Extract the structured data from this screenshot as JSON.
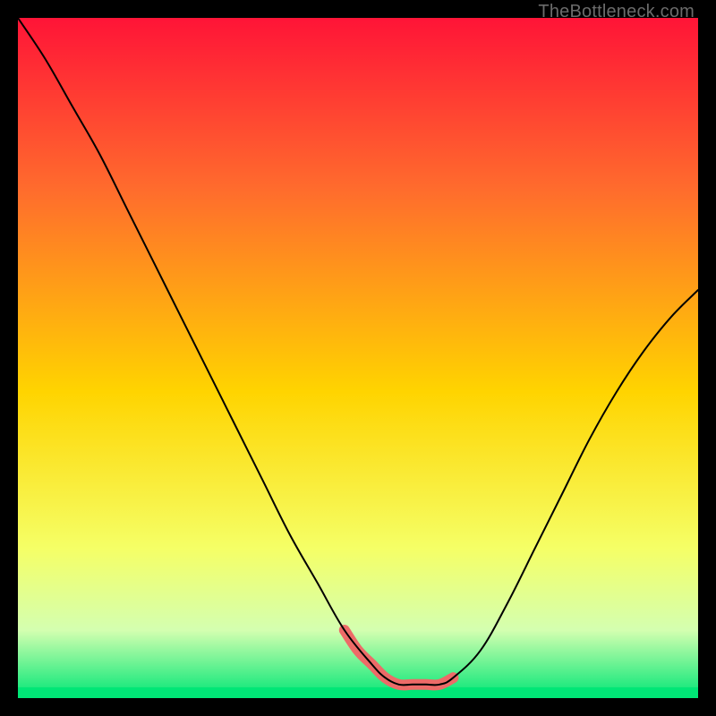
{
  "watermark": "TheBottleneck.com",
  "chart_data": {
    "type": "line",
    "title": "",
    "xlabel": "",
    "ylabel": "",
    "xlim": [
      0,
      100
    ],
    "ylim": [
      0,
      100
    ],
    "gradient_stops": [
      {
        "offset": 0,
        "color": "#ff1437"
      },
      {
        "offset": 25,
        "color": "#ff6b2d"
      },
      {
        "offset": 55,
        "color": "#ffd400"
      },
      {
        "offset": 78,
        "color": "#f5ff66"
      },
      {
        "offset": 90,
        "color": "#d4ffb0"
      },
      {
        "offset": 100,
        "color": "#00e676"
      }
    ],
    "series": [
      {
        "name": "bottleneck-curve",
        "x": [
          0,
          4,
          8,
          12,
          16,
          20,
          24,
          28,
          32,
          36,
          40,
          44,
          48,
          52,
          54,
          56,
          58,
          60,
          62,
          64,
          68,
          72,
          76,
          80,
          84,
          88,
          92,
          96,
          100
        ],
        "y": [
          100,
          94,
          87,
          80,
          72,
          64,
          56,
          48,
          40,
          32,
          24,
          17,
          10,
          5,
          3,
          2,
          2,
          2,
          2,
          3,
          7,
          14,
          22,
          30,
          38,
          45,
          51,
          56,
          60
        ]
      }
    ],
    "accent_segment": {
      "name": "highlight-valley",
      "x": [
        48,
        50,
        52,
        54,
        56,
        58,
        60,
        62,
        64
      ],
      "y": [
        10,
        7,
        5,
        3,
        2,
        2,
        2,
        2,
        3
      ]
    }
  }
}
